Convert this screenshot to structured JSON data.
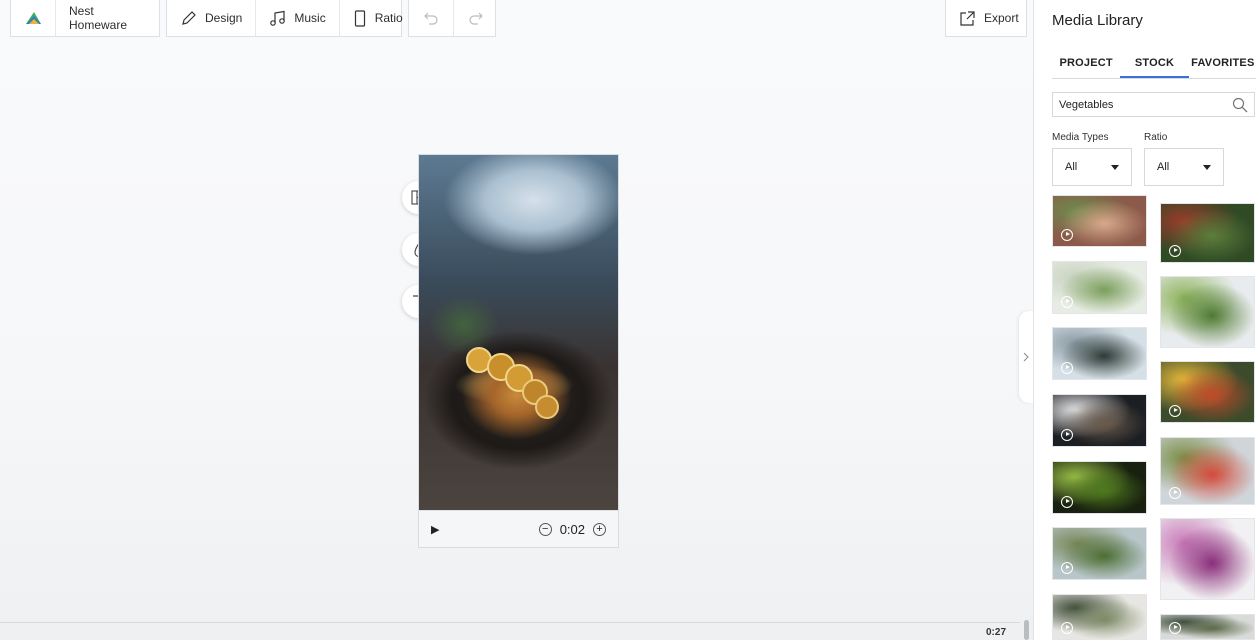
{
  "toolbar": {
    "project_name": "Nest Homeware",
    "design_label": "Design",
    "music_label": "Music",
    "ratio_label": "Ratio",
    "export_label": "Export"
  },
  "preview": {
    "time": "0:02"
  },
  "timeline": {
    "total_time": "0:27"
  },
  "media_library": {
    "title": "Media Library",
    "tabs": [
      {
        "label": "PROJECT"
      },
      {
        "label": "STOCK",
        "active": true
      },
      {
        "label": "FAVORITES"
      }
    ],
    "search_value": "Vegetables",
    "filters": {
      "media_types_label": "Media Types",
      "media_types_value": "All",
      "ratio_label": "Ratio",
      "ratio_value": "All"
    },
    "results": [
      {
        "kind": "video",
        "colors": [
          "#8b5a4a",
          "#d9a88b",
          "#6e8a4c"
        ]
      },
      {
        "kind": "video",
        "colors": [
          "#2f4a25",
          "#5a7e3b",
          "#9b3a2a"
        ]
      },
      {
        "kind": "video",
        "colors": [
          "#e7ece4",
          "#7a9f5a",
          "#c8d3c0"
        ]
      },
      {
        "kind": "image",
        "colors": [
          "#e9ecee",
          "#4f7a31",
          "#8db35a"
        ]
      },
      {
        "kind": "video",
        "colors": [
          "#d5dfe6",
          "#2d3a35",
          "#8a9aa3"
        ]
      },
      {
        "kind": "video",
        "colors": [
          "#3c4b2b",
          "#c04a2a",
          "#e6b93a"
        ]
      },
      {
        "kind": "video",
        "colors": [
          "#1b1e22",
          "#6a5a4a",
          "#e6e6e6"
        ]
      },
      {
        "kind": "video",
        "colors": [
          "#cfd5d9",
          "#d44a3a",
          "#7a8d45"
        ]
      },
      {
        "kind": "video",
        "colors": [
          "#18200f",
          "#4e7a1f",
          "#9ac048"
        ]
      },
      {
        "kind": "image",
        "colors": [
          "#f1f0f2",
          "#8a2e7a",
          "#c87ab8"
        ]
      },
      {
        "kind": "video",
        "colors": [
          "#b8c6c9",
          "#4d6e34",
          "#7a8a5c"
        ]
      },
      {
        "kind": "video",
        "colors": [
          "#d9dbd8",
          "#5c6a4a",
          "#3b4a3a"
        ]
      },
      {
        "kind": "video",
        "colors": [
          "#e7e6e2",
          "#7e8a66",
          "#3c4a36"
        ]
      }
    ]
  }
}
